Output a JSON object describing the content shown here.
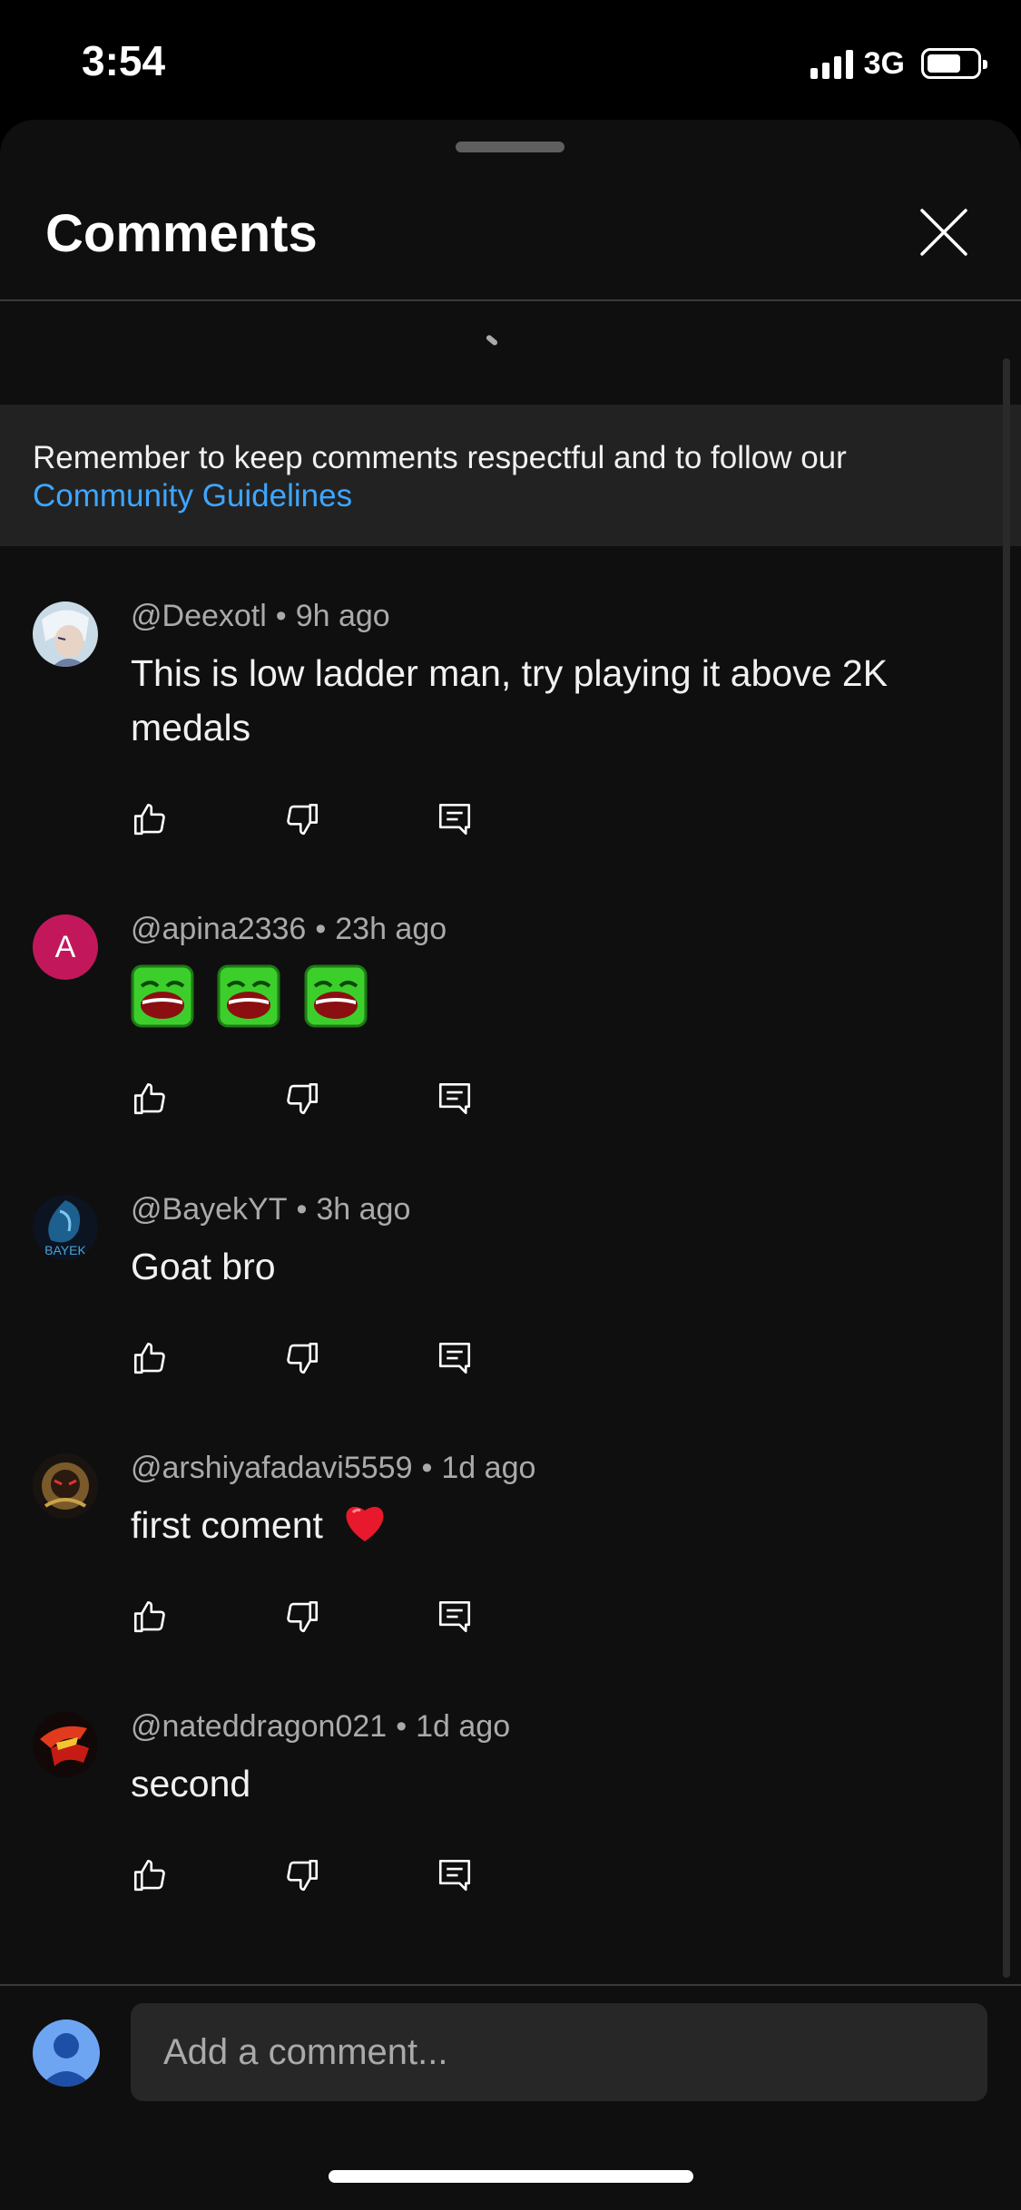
{
  "status_bar": {
    "time": "3:54",
    "network": "3G"
  },
  "sheet": {
    "title": "Comments",
    "close_icon": "close-icon"
  },
  "notice": {
    "text": "Remember to keep comments respectful and to follow our",
    "link": "Community Guidelines",
    "link_color": "#3ea6ff"
  },
  "comments": [
    {
      "author": "@Deexotl",
      "time": "9h ago",
      "text": "This is low ladder man, try playing it above 2K medals"
    },
    {
      "author": "@apina2336",
      "time": "23h ago",
      "text": "",
      "avatar_letter": "A",
      "avatar_color": "#c2185b",
      "emoji_count": 3
    },
    {
      "author": "@BayekYT",
      "time": "3h ago",
      "text": "Goat bro"
    },
    {
      "author": "@arshiyafadavi5559",
      "time": "1d ago",
      "text": "first coment",
      "trailing_emoji": "❤️"
    },
    {
      "author": "@nateddragon021",
      "time": "1d ago",
      "text": "second"
    }
  ],
  "dot_separator": "•",
  "composer": {
    "placeholder": "Add a comment..."
  }
}
